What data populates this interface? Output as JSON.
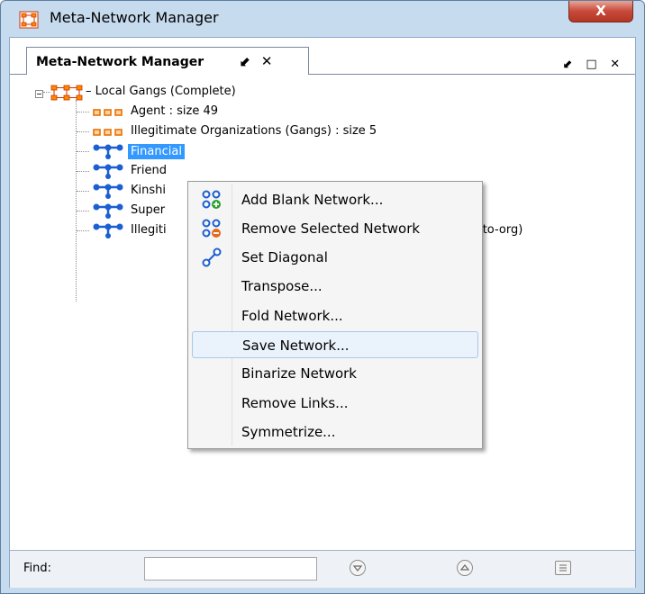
{
  "window": {
    "title": "Meta-Network Manager",
    "close_label": "X"
  },
  "tab": {
    "label": "Meta-Network Manager",
    "undock": "⬋",
    "close": "✕"
  },
  "pane_buttons": "⬋ □ ✕",
  "tree": {
    "root": "Local Gangs (Complete)",
    "items": [
      {
        "label": "Agent : size 49",
        "kind": "node"
      },
      {
        "label": "Illegitimate Organizations (Gangs) : size 5",
        "kind": "node"
      },
      {
        "label": "Financial",
        "kind": "network",
        "selected": true
      },
      {
        "label": "Friend",
        "kind": "network"
      },
      {
        "label": "Kinshi",
        "kind": "network"
      },
      {
        "label": "Super",
        "kind": "network"
      },
      {
        "label": "Illegiti",
        "kind": "network"
      }
    ],
    "trailing_text": "-to-org)"
  },
  "context_menu": {
    "items": [
      {
        "label": "Add Blank Network...",
        "icon": "add-network-icon"
      },
      {
        "label": "Remove Selected Network",
        "icon": "remove-network-icon"
      },
      {
        "label": "Set Diagonal",
        "icon": "diagonal-icon"
      },
      {
        "label": "Transpose..."
      },
      {
        "label": "Fold Network..."
      },
      {
        "label": "Save Network...",
        "highlighted": true
      },
      {
        "label": "Binarize Network"
      },
      {
        "label": "Remove Links..."
      },
      {
        "label": "Symmetrize..."
      }
    ]
  },
  "find": {
    "label": "Find:",
    "value": ""
  },
  "colors": {
    "selection": "#3399ff",
    "node_icon": "#e8710a",
    "network_icon": "#1b5fd1",
    "close_button": "#c8493a"
  }
}
